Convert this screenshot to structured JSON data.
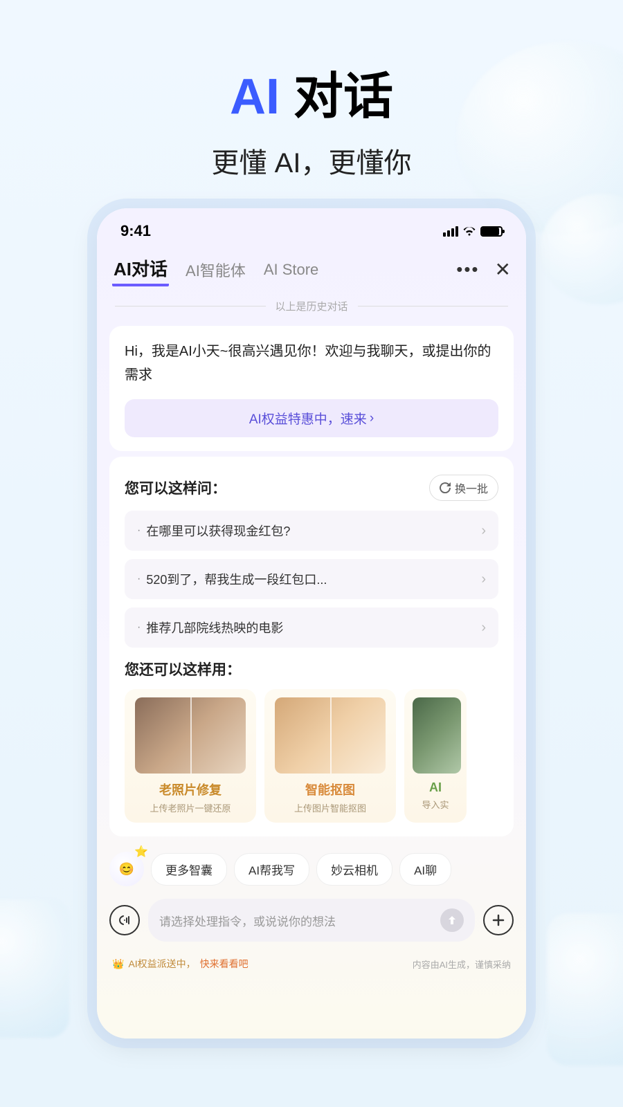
{
  "hero": {
    "title_ai": "AI",
    "title_rest": " 对话",
    "subtitle": "更懂 AI，更懂你"
  },
  "status": {
    "time": "9:41"
  },
  "tabs": {
    "items": [
      {
        "label": "AI对话",
        "active": true
      },
      {
        "label": "AI智能体",
        "active": false
      },
      {
        "label": "AI Store",
        "active": false
      }
    ]
  },
  "history_divider": "以上是历史对话",
  "greeting": {
    "text": "Hi，我是AI小天~很高兴遇见你！欢迎与我聊天，或提出你的需求",
    "promo": "AI权益特惠中，速来"
  },
  "suggestions": {
    "title": "您可以这样问：",
    "refresh": "换一批",
    "items": [
      "在哪里可以获得现金红包?",
      "520到了，帮我生成一段红包口...",
      "推荐几部院线热映的电影"
    ]
  },
  "features": {
    "title": "您还可以这样用：",
    "cards": [
      {
        "title": "老照片修复",
        "sub": "上传老照片一键还原"
      },
      {
        "title": "智能抠图",
        "sub": "上传图片智能抠图"
      },
      {
        "title": "AI",
        "sub": "导入实"
      }
    ]
  },
  "chips": [
    "更多智囊",
    "AI帮我写",
    "妙云相机",
    "AI聊"
  ],
  "input": {
    "placeholder": "请选择处理指令，或说说你的想法"
  },
  "footer": {
    "left_text": "AI权益派送中，",
    "left_link": "快来看看吧",
    "right": "内容由AI生成，谨慎采纳"
  }
}
